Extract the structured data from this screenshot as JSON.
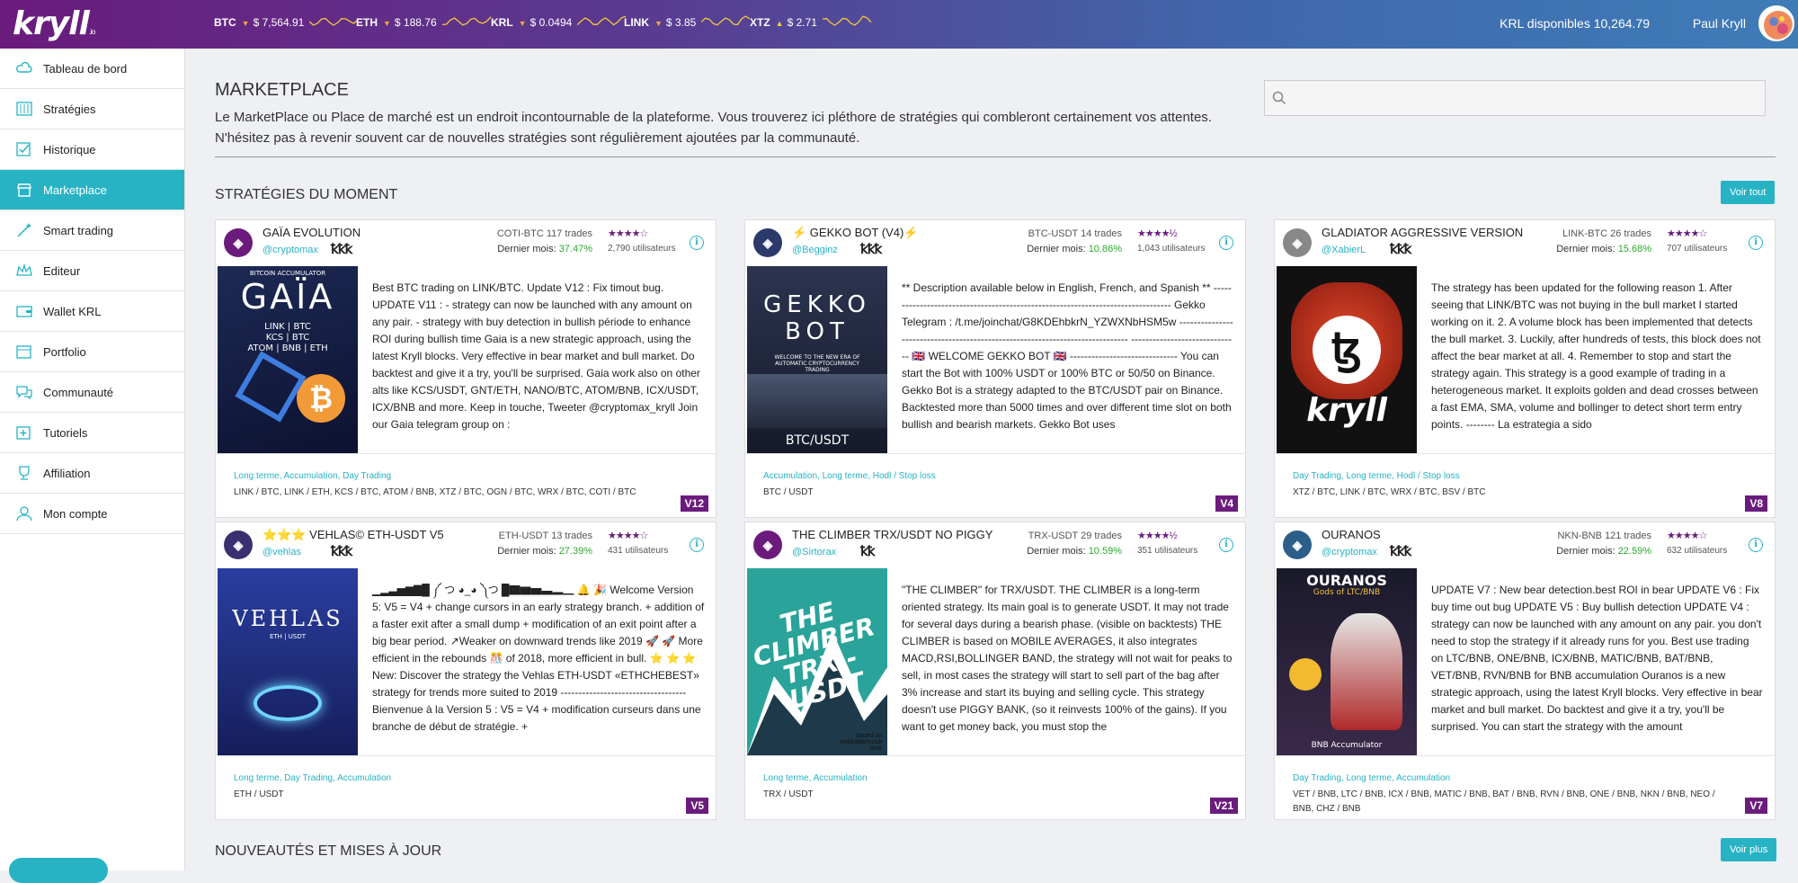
{
  "topbar": {
    "logo": "kryll",
    "logo_suffix": ".io",
    "tickers": [
      {
        "symbol": "BTC",
        "dir": "▼",
        "price": "$ 7,564.91"
      },
      {
        "symbol": "ETH",
        "dir": "▼",
        "price": "$ 188.76"
      },
      {
        "symbol": "KRL",
        "dir": "▼",
        "price": "$ 0.0494"
      },
      {
        "symbol": "LINK",
        "dir": "▼",
        "price": "$ 3.85"
      },
      {
        "symbol": "XTZ",
        "dir": "▲",
        "price": "$ 2.71"
      }
    ],
    "krl_available": "KRL disponibles 10,264.79",
    "user_name": "Paul Kryll"
  },
  "sidebar": {
    "items": [
      {
        "label": "Tableau de bord",
        "icon": "cloud-dashboard-icon"
      },
      {
        "label": "Stratégies",
        "icon": "sliders-icon"
      },
      {
        "label": "Historique",
        "icon": "checklist-icon"
      },
      {
        "label": "Marketplace",
        "icon": "store-icon"
      },
      {
        "label": "Smart trading",
        "icon": "magic-wand-icon"
      },
      {
        "label": "Editeur",
        "icon": "crown-icon"
      },
      {
        "label": "Wallet KRL",
        "icon": "wallet-icon"
      },
      {
        "label": "Portfolio",
        "icon": "portfolio-icon"
      },
      {
        "label": "Communauté",
        "icon": "chat-bubbles-icon"
      },
      {
        "label": "Tutoriels",
        "icon": "tutorial-plus-icon"
      },
      {
        "label": "Affiliation",
        "icon": "trophy-icon"
      },
      {
        "label": "Mon compte",
        "icon": "user-icon"
      }
    ]
  },
  "main": {
    "title": "MARKETPLACE",
    "description": "Le MarketPlace ou Place de marché est un endroit incontournable de la plateforme. Vous trouverez ici pléthore de stratégies qui combleront certainement vos attentes. N'hésitez pas à revenir souvent car de nouvelles stratégies sont régulièrement ajoutées par la communauté.",
    "section1": "STRATÉGIES DU MOMENT",
    "see_all": "Voir tout",
    "section2": "NOUVEAUTÉS ET MISES À JOUR",
    "see_more": "Voir plus"
  },
  "cards": [
    {
      "name": "GAÏA EVOLUTION",
      "author": "@cryptomax",
      "pair": "COTI-BTC 117 trades",
      "month_label": "Dernier mois:",
      "month": "37.47%",
      "stars": "★★★★☆",
      "users": "2,790 utilisateurs",
      "badges": "ꝁꝁꝁ",
      "image_title": "GAÏA",
      "image_sub": "BITCOIN ACCUMULATOR",
      "image_lines": "LINK | BTC\nKCS | BTC\nATOM | BNB | ETH",
      "description": "Best BTC trading on LINK/BTC. Update V12 : Fix timout bug. UPDATE V11 : - strategy can now be launched with any amount on any pair. - strategy with buy detection in bullish période to enhance ROI during bullish time Gaia is a new strategic approach, using the latest Kryll blocks. Very effective in bear market and bull market. Do backtest and give it a try, you'll be surprised. Gaia work also on other alts like KCS/USDT, GNT/ETH, NANO/BTC, ATOM/BNB, ICX/USDT, ICX/BNB and more. Keep in touche, Tweeter @cryptomax_kryll Join our Gaia telegram group on :",
      "tags": "Long terme, Accumulation, Day Trading",
      "pairs": "LINK / BTC, LINK / ETH, KCS / BTC, ATOM / BNB, XTZ / BTC, OGN / BTC, WRX / BTC, COTI / BTC",
      "version": "V12"
    },
    {
      "name": "⚡ GEKKO BOT (V4)⚡",
      "author": "@Begginz",
      "pair": "BTC-USDT 14 trades",
      "month_label": "Dernier mois:",
      "month": "10.86%",
      "stars": "★★★★½",
      "users": "1,043 utilisateurs",
      "badges": "ꝁꝁꝁ",
      "image_title": "GEKKO BOT",
      "image_sub": "WELCOME TO THE NEW ERA OF AUTOMATIC CRYPTOCURRENCY TRADING",
      "image_lines": "BTC/USDT",
      "description": "** Description available below in English, French, and Spanish ** -------------------------------------------------------------------------------- Gekko Telegram : /t.me/joinchat/G8KDEhbkrN_YZWXNbHSM5w ------------------------------------------------------------------------------ ------------------------------ 🇬🇧 WELCOME GEKKO BOT 🇬🇧 ------------------------------ You can start the Bot with 100% USDT or 100% BTC or 50/50 on Binance. Gekko Bot is a strategy adapted to the BTC/USDT pair on Binance. Backtested more than 5000 times and over different time slot on both bullish and bearish markets. Gekko Bot uses",
      "tags": "Accumulation, Long terme, Hodl / Stop loss",
      "pairs": "BTC / USDT",
      "version": "V4"
    },
    {
      "name": "GLADIATOR AGGRESSIVE VERSION",
      "author": "@XabierL",
      "pair": "LINK-BTC 26 trades",
      "month_label": "Dernier mois:",
      "month": "15.68%",
      "stars": "★★★★☆",
      "users": "707 utilisateurs",
      "badges": "ꝁꝁꝁ",
      "image_title": "kryll",
      "image_sub": "",
      "image_lines": "",
      "description": "The strategy has been updated for the following reason 1. After seeing that LINK/BTC was not buying in the bull market I started working on it. 2. A volume block has been implemented that detects the bull market. 3. Luckily, after hundreds of tests, this block does not affect the bear market at all. 4. Remember to stop and start the strategy again. This strategy is a good example of trading in a heterogeneous market. It exploits golden and dead crosses between a fast EMA, SMA, volume and bollinger to detect short term entry points. -------- La estrategia a sido",
      "tags": "Day Trading, Long terme, Hodl / Stop loss",
      "pairs": "XTZ / BTC, LINK / BTC, WRX / BTC, BSV / BTC",
      "version": "V8"
    },
    {
      "name": "⭐⭐⭐ VEHLAS© ETH-USDT V5",
      "author": "@vehlas",
      "pair": "ETH-USDT 13 trades",
      "month_label": "Dernier mois:",
      "month": "27.39%",
      "stars": "★★★★☆",
      "users": "431 utilisateurs",
      "badges": "ꝁꝁꝁ",
      "image_title": "VEHLAS",
      "image_sub": "ETH | USDT",
      "image_lines": "",
      "description": "▁▂▃▅▆▇█ ༼ つ ◕_◕ ༽つ █▇▆▅▃▂▁ 🔔 🎉 Welcome Version 5: V5 = V4 + change cursors in an early strategy branch. + addition of a faster exit after a small dump + modification of an exit point after a big bear period. ↗Weaker on downward trends like 2019 🚀 🚀 More efficient in the rebounds 🎊 of 2018, more efficient in bull. ⭐ ⭐ ⭐ New: Discover the strategy the Vehlas ETH-USDT «ETHCHEBEST» strategy for trends more suited to 2019 ----------------------------------- Bienvenue à la Version 5 : V5 = V4 + modification curseurs dans une branche de début de stratégie. +",
      "tags": "Long terme, Day Trading, Accumulation",
      "pairs": "ETH / USDT",
      "version": "V5"
    },
    {
      "name": "THE CLIMBER TRX/USDT NO PIGGY",
      "author": "@Sirtorax",
      "pair": "TRX-USDT 29 trades",
      "month_label": "Dernier mois:",
      "month": "10.59%",
      "stars": "★★★★½",
      "users": "351 utilisateurs",
      "badges": "ꝁꝁ",
      "image_title": "THE CLIMBER TRX - USDT",
      "image_sub": "based on nostradamusdt strat",
      "image_lines": "",
      "description": "\"THE CLIMBER\" for TRX/USDT. THE CLIMBER is a long-term oriented strategy. Its main goal is to generate USDT. It may not trade for several days during a bearish phase. (visible on backtests) THE CLIMBER is based on MOBILE AVERAGES, it also integrates MACD,RSI,BOLLINGER BAND, the strategy will not wait for peaks to sell, in most cases the strategy will start to sell part of the bag after 3% increase and start its buying and selling cycle. This strategy doesn't use PIGGY BANK, (so it reinvests 100% of the gains). If you want to get money back, you must stop the",
      "tags": "Long terme, Accumulation",
      "pairs": "TRX / USDT",
      "version": "V21"
    },
    {
      "name": "OURANOS",
      "author": "@cryptomax",
      "pair": "NKN-BNB 121 trades",
      "month_label": "Dernier mois:",
      "month": "22.59%",
      "stars": "★★★★☆",
      "users": "632 utilisateurs",
      "badges": "ꝁꝁꝁ",
      "image_title": "OURANOS",
      "image_sub": "Gods of LTC/BNB",
      "image_lines": "BNB Accumulator",
      "description": "UPDATE V7 : New bear detection.best ROI in bear UPDATE V6 : Fix buy time out bug UPDATE V5 : Buy bullish detection UPDATE V4 : strategy can now be launched with any amount on any pair. you don't need to stop the strategy if it already runs for you. Best use trading on LTC/BNB, ONE/BNB, ICX/BNB, MATIC/BNB, BAT/BNB, VET/BNB, RVN/BNB for BNB accumulation Ouranos is a new strategic approach, using the latest Kryll blocks. Very effective in bear market and bull market. Do backtest and give it a try, you'll be surprised. You can start the strategy with the amount",
      "tags": "Day Trading, Long terme, Accumulation",
      "pairs": "VET / BNB, LTC / BNB, ICX / BNB, MATIC / BNB, BAT / BNB, RVN / BNB, ONE / BNB, NKN / BNB, NEO / BNB, CHZ / BNB",
      "version": "V7"
    }
  ]
}
